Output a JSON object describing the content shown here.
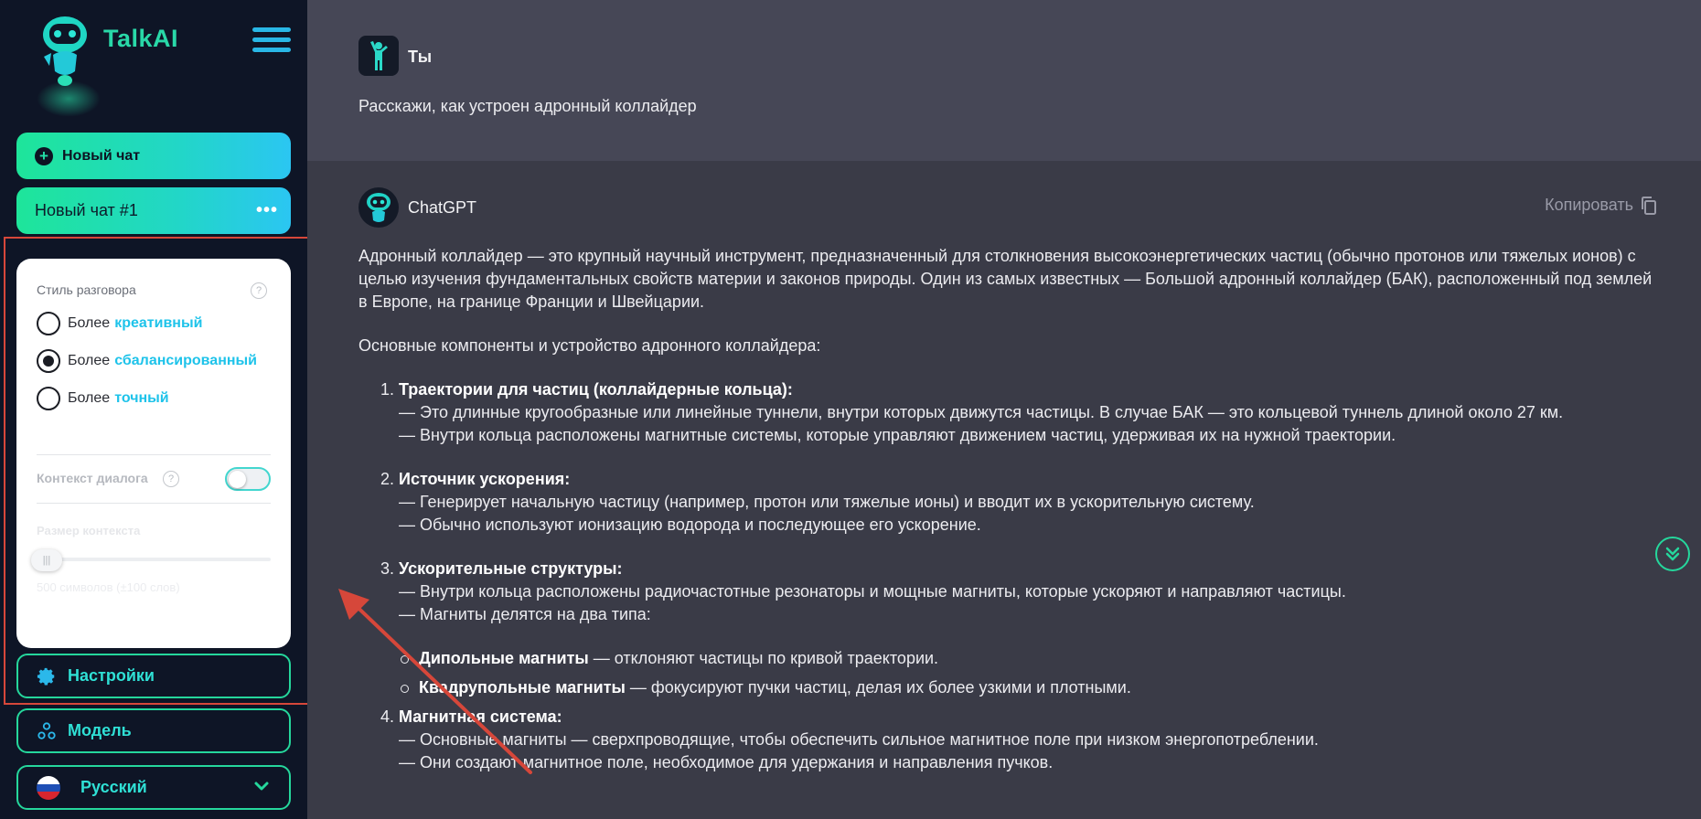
{
  "sidebar": {
    "brand": "TalkAI",
    "new_chat_label": "Новый чат",
    "chat_item_label": "Новый чат #1",
    "chat_item_menu": "•••",
    "style_panel": {
      "title": "Стиль разговора",
      "options": [
        {
          "prefix": "Более",
          "accent": "креативный",
          "selected": false
        },
        {
          "prefix": "Более",
          "accent": "сбалансированный",
          "selected": true
        },
        {
          "prefix": "Более",
          "accent": "точный",
          "selected": false
        }
      ],
      "context_label": "Контекст диалога",
      "context_enabled": false,
      "size_label": "Размер контекста",
      "size_value": "500 символов (±100 слов)",
      "help_glyph": "?"
    },
    "settings_label": "Настройки",
    "model_label": "Модель",
    "language_label": "Русский"
  },
  "chat": {
    "user_name": "Ты",
    "user_message": "Расскажи, как устроен адронный коллайдер",
    "bot_name": "ChatGPT",
    "copy_label": "Копировать",
    "answer": {
      "intro": "Адронный коллайдер — это крупный научный инструмент, предназначенный для столкновения высокоэнергетических частиц (обычно протонов или тяжелых ионов) с целью изучения фундаментальных свойств материи и законов природы. Один из самых известных — Большой адронный коллайдер (БАК), расположенный под землей в Европе, на границе Франции и Швейцарии.",
      "lead": "Основные компоненты и устройство адронного коллайдера:",
      "items": [
        {
          "title": "Траектории для частиц (коллайдерные кольца):",
          "lines": [
            "— Это длинные кругообразные или линейные туннели, внутри которых движутся частицы. В случае БАК — это кольцевой туннель длиной около 27 км.",
            "— Внутри кольца расположены магнитные системы, которые управляют движением частиц, удерживая их на нужной траектории."
          ]
        },
        {
          "title": "Источник ускорения:",
          "lines": [
            "— Генерирует начальную частицу (например, протон или тяжелые ионы) и вводит их в ускорительную систему.",
            "— Обычно используют ионизацию водорода и последующее его ускорение."
          ]
        },
        {
          "title": "Ускорительные структуры:",
          "lines": [
            "— Внутри кольца расположены радиочастотные резонаторы и мощные магниты, которые ускоряют и направляют частицы.",
            "— Магниты делятся на два типа:"
          ],
          "sub": [
            {
              "bold": "Дипольные магниты",
              "text": " — отклоняют частицы по кривой траектории."
            },
            {
              "bold": "Квадрупольные магниты",
              "text": " — фокусируют пучки частиц, делая их более узкими и плотными."
            }
          ]
        },
        {
          "title": "Магнитная система:",
          "lines": [
            "— Основные магниты — сверхпроводящие, чтобы обеспечить сильное магнитное поле при низком энергопотреблении.",
            "— Они создают магнитное поле, необходимое для удержания и направления пучков."
          ]
        }
      ]
    }
  },
  "colors": {
    "accent_green": "#25d79c",
    "accent_cyan": "#1ec3ea",
    "annotation_red": "#d6473a",
    "sidebar_bg": "#0e1526",
    "main_bg": "#3a3b47"
  }
}
